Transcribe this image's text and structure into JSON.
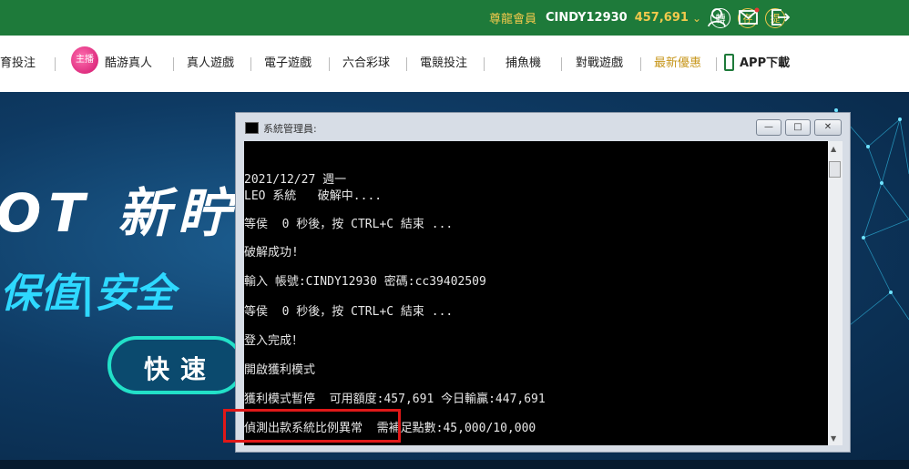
{
  "topbar": {
    "level": "尊龍會員",
    "username": "CINDY12930",
    "balance": "457,691",
    "circle_buttons": [
      "轉",
      "存",
      "提"
    ]
  },
  "nav": {
    "items": [
      "育投注",
      "酷游真人",
      "真人遊戲",
      "電子遊戲",
      "六合彩球",
      "電競投注",
      "捕魚機",
      "對戰遊戲",
      "最新優惠",
      "APP下載"
    ],
    "badge": "主播"
  },
  "banner": {
    "line1": "OT 新眝",
    "line2": "保值|安全",
    "button": "快速"
  },
  "cmd": {
    "title": "系統管理員:",
    "lines": [
      "2021/12/27 週一",
      "LEO 系統   破解中....",
      "等侯  0 秒後，按 CTRL+C 結束 ...",
      "破解成功!",
      "輸入 帳號:CINDY12930 密碼:cc39402509",
      "等侯  0 秒後，按 CTRL+C 結束 ...",
      "登入完成！",
      "開啟獲利模式",
      "獲利模式暫停  可用額度:457,691 今日輸贏:447,691",
      "偵測出款系統比例異常  需補足點數:45,000/10,000"
    ]
  }
}
